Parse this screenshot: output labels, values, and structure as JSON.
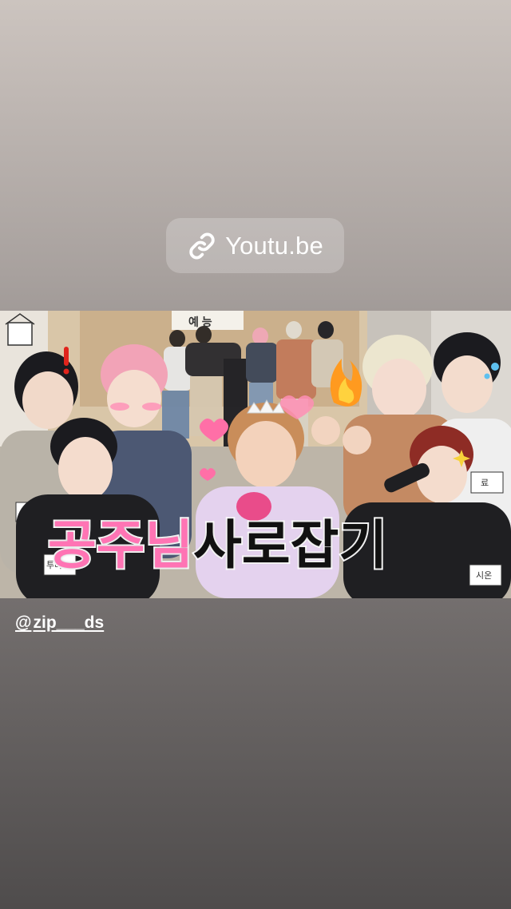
{
  "link_sticker": {
    "icon": "link-icon",
    "label": "Youtu.be"
  },
  "thumbnail": {
    "title_pink": "공주님",
    "title_black": "사로잡기",
    "sign_text": "예 능",
    "name_tags": [
      "투다",
      "료",
      "시온"
    ],
    "accent_colors": {
      "title_pink": "#ff74b4",
      "title_black": "#111111",
      "stroke": "#ffffff"
    }
  },
  "mention": {
    "icon": "threads-icon",
    "icon_glyph": "@",
    "handle": "zip___ds"
  }
}
